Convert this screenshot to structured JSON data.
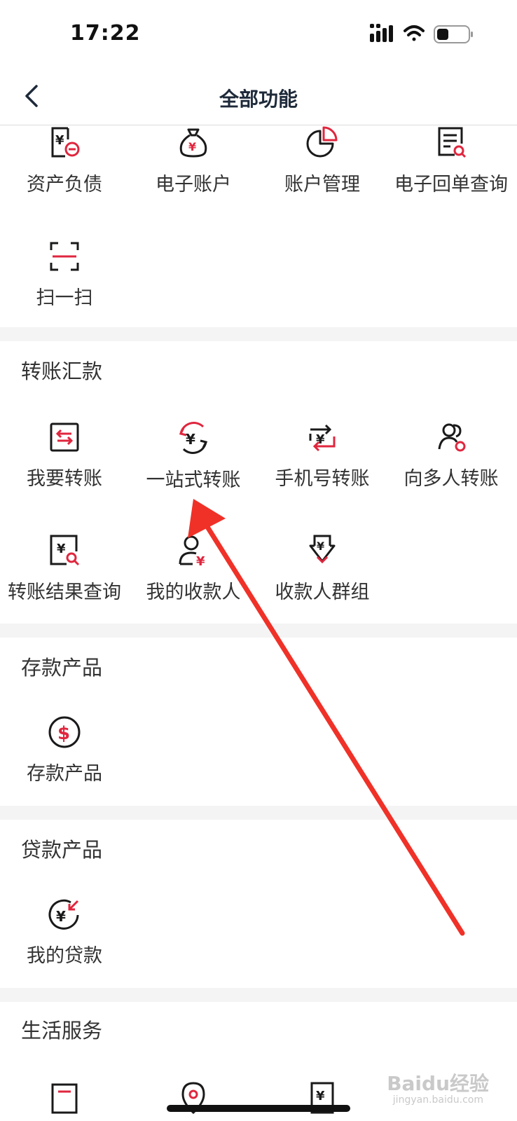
{
  "status_bar": {
    "time": "17:22"
  },
  "nav": {
    "title": "全部功能"
  },
  "top_items": [
    {
      "label": "资产负债",
      "icon": "asset-debt-icon"
    },
    {
      "label": "电子账户",
      "icon": "money-bag-icon"
    },
    {
      "label": "账户管理",
      "icon": "pie-chart-icon"
    },
    {
      "label": "电子回单查询",
      "icon": "receipt-search-icon"
    },
    {
      "label": "扫一扫",
      "icon": "scan-icon"
    }
  ],
  "sections": [
    {
      "title": "转账汇款",
      "items": [
        {
          "label": "我要转账",
          "icon": "transfer-icon"
        },
        {
          "label": "一站式转账",
          "icon": "one-stop-transfer-icon"
        },
        {
          "label": "手机号转账",
          "icon": "phone-transfer-icon"
        },
        {
          "label": "向多人转账",
          "icon": "multi-transfer-icon"
        },
        {
          "label": "转账结果查询",
          "icon": "transfer-result-icon"
        },
        {
          "label": "我的收款人",
          "icon": "payee-icon"
        },
        {
          "label": "收款人群组",
          "icon": "payee-group-icon"
        }
      ]
    },
    {
      "title": "存款产品",
      "items": [
        {
          "label": "存款产品",
          "icon": "dollar-coin-icon"
        }
      ]
    },
    {
      "title": "贷款产品",
      "items": [
        {
          "label": "我的贷款",
          "icon": "loan-icon"
        }
      ]
    },
    {
      "title": "生活服务",
      "items": []
    }
  ],
  "watermark": {
    "text": "Baidu经验",
    "sub": "jingyan.baidu.com"
  },
  "colors": {
    "accent": "#e0263e",
    "arrow": "#f03128",
    "icon": "#1a1a1a",
    "separator": "#f4f4f5"
  }
}
